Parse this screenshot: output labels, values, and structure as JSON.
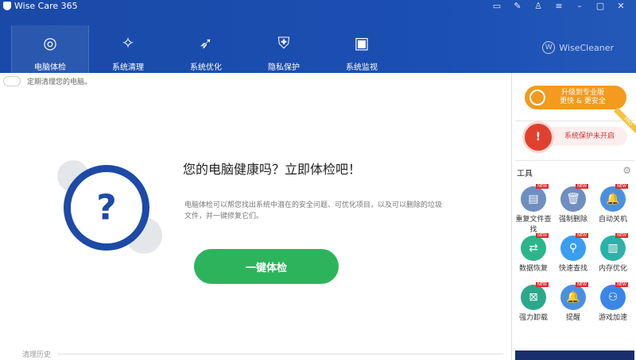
{
  "app": {
    "title": "Wise Care 365",
    "brand": "WiseCleaner",
    "brand_mark": "W"
  },
  "window_buttons": [
    {
      "name": "feedback",
      "glyph": "▭"
    },
    {
      "name": "edit",
      "glyph": "✎"
    },
    {
      "name": "skin",
      "glyph": "♙"
    },
    {
      "name": "menu",
      "glyph": "≡"
    },
    {
      "name": "minimize",
      "glyph": "–"
    },
    {
      "name": "maximize",
      "glyph": "▢"
    },
    {
      "name": "close",
      "glyph": "✕"
    }
  ],
  "tabs": [
    {
      "label": "电脑体检",
      "icon": "◎"
    },
    {
      "label": "系统清理",
      "icon": "✧"
    },
    {
      "label": "系统优化",
      "icon": "➶"
    },
    {
      "label": "隐私保护",
      "icon": "⛨"
    },
    {
      "label": "系统监视",
      "icon": "▣"
    }
  ],
  "schedule": {
    "label": "定期清理您的电脑。"
  },
  "main": {
    "icon": "?",
    "headline": "您的电脑健康吗？立即体检吧！",
    "description": "电脑体检可以帮您找出系统中潜在的安全问题、可优化项目，以及可以删除的垃圾文件，并一键修复它们。",
    "button": "一键体检",
    "history": "清理历史"
  },
  "sidebar": {
    "upgrade_line1": "升级到专业版",
    "upgrade_line2": "更快 & 更安全",
    "protection": "系统保护未开启",
    "pro_badge": "PRO",
    "shield": "!",
    "tools_title": "工具",
    "new_badge": "NEW",
    "tools": [
      {
        "label": "重复文件查找",
        "color": "#6f8fc0",
        "glyph": "▤"
      },
      {
        "label": "强制删除",
        "color": "#6f8fc0",
        "glyph": "🗑"
      },
      {
        "label": "自动关机",
        "color": "#4a90e2",
        "glyph": "🔔"
      },
      {
        "label": "数据恢复",
        "color": "#2cb58a",
        "glyph": "⇄"
      },
      {
        "label": "快速查找",
        "color": "#3a9ef0",
        "glyph": "⚲"
      },
      {
        "label": "内存优化",
        "color": "#29b3a8",
        "glyph": "▥"
      },
      {
        "label": "强力卸载",
        "color": "#2aa88a",
        "glyph": "⊠"
      },
      {
        "label": "提醒",
        "color": "#4a90e2",
        "glyph": "🔔"
      },
      {
        "label": "游戏加速",
        "color": "#3a86e6",
        "glyph": "⚇"
      }
    ]
  }
}
